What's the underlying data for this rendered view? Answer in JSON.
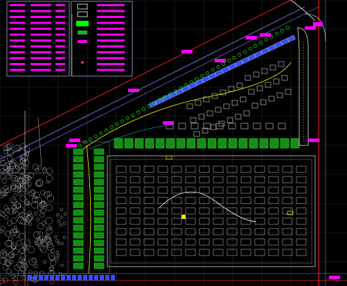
{
  "app": {
    "type": "CAD drawing viewport",
    "background": "#000000"
  },
  "legend": {
    "table_color": "#ff00ff",
    "row_count": 12
  },
  "colors": {
    "road_red": "#ff2020",
    "grid_gray": "#555555",
    "building_blue": "#3050ff",
    "green_space": "#00ff00",
    "white_lines": "#e8e8e8",
    "magenta_tag": "#ff00ff",
    "yellow": "#ffff00",
    "cyan": "#00e0ff",
    "gray_trees": "#b0b0b0"
  },
  "labels": {
    "note_1": "",
    "note_2": ""
  }
}
